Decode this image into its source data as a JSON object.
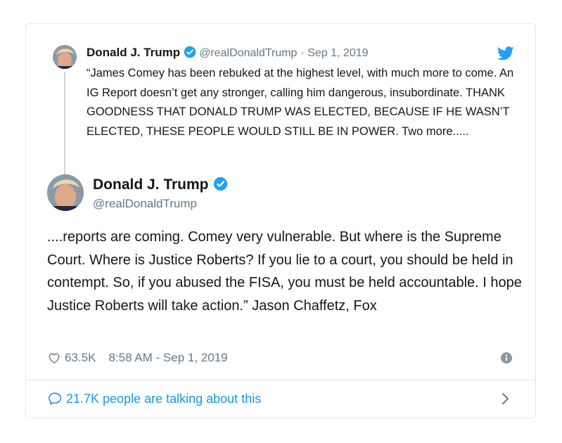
{
  "colors": {
    "accent": "#1da1f2",
    "link": "#1b95e0",
    "secondary_text": "#657786",
    "border": "#e1e8ed"
  },
  "icons": [
    "twitter-bird-icon",
    "verified-badge-icon",
    "heart-icon",
    "info-icon",
    "speech-bubble-icon",
    "chevron-right-icon"
  ],
  "quoted_tweet": {
    "name": "Donald J. Trump",
    "handle": "@realDonaldTrump",
    "separator": "·",
    "date": "Sep 1, 2019",
    "text": "“James Comey has been rebuked at the highest level, with much more to come. An IG Report doesn’t get any stronger, calling him dangerous, insubordinate. THANK GOODNESS THAT DONALD TRUMP WAS ELECTED, BECAUSE IF HE WASN’T ELECTED, THESE PEOPLE WOULD STILL BE IN POWER. Two more....."
  },
  "main_tweet": {
    "name": "Donald J. Trump",
    "handle": "@realDonaldTrump",
    "text": "....reports are coming. Comey very vulnerable. But where is the Supreme Court. Where is Justice Roberts? If you lie to a court, you should be held in contempt. So, if you abused the FISA, you must be held accountable. I hope Justice Roberts will take action.” Jason Chaffetz, Fox",
    "likes": "63.5K",
    "timestamp": "8:58 AM - Sep 1, 2019"
  },
  "footer": {
    "talking_label": "21.7K people are talking about this"
  }
}
